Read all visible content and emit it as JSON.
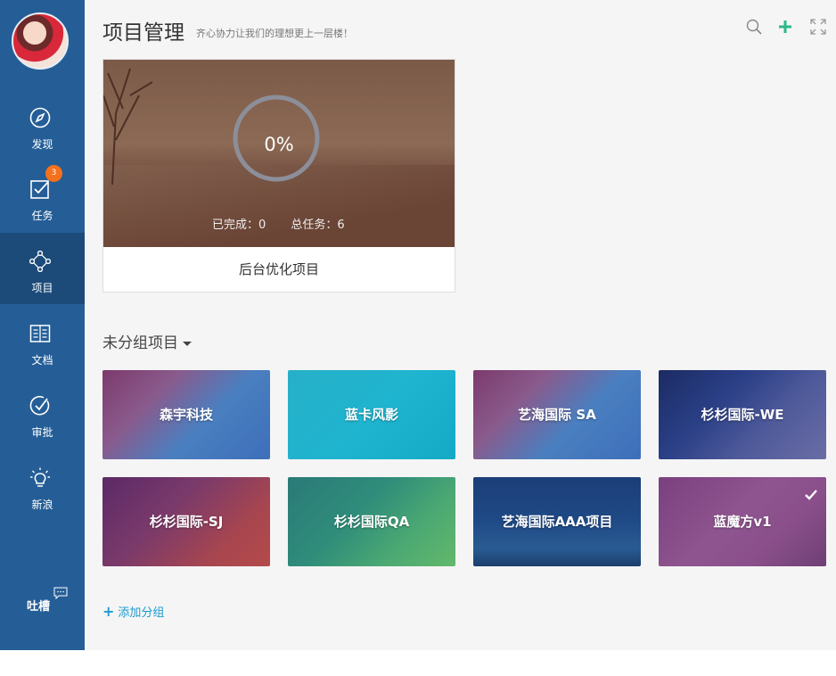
{
  "sidebar": {
    "items": [
      {
        "label": "发现",
        "icon": "compass-icon"
      },
      {
        "label": "任务",
        "icon": "checkbox-icon",
        "badge": "3"
      },
      {
        "label": "项目",
        "icon": "project-nodes-icon",
        "active": true
      },
      {
        "label": "文档",
        "icon": "book-icon"
      },
      {
        "label": "审批",
        "icon": "approval-icon"
      },
      {
        "label": "新浪",
        "icon": "lightbulb-icon"
      }
    ],
    "feedback_label": "吐槽"
  },
  "header": {
    "title": "项目管理",
    "subtitle": "齐心协力让我们的理想更上一层楼！",
    "icons": [
      "search-icon",
      "plus-icon",
      "fullscreen-icon"
    ],
    "accent": "#2bb98a"
  },
  "featured": {
    "progress": "0%",
    "progress_value": 0,
    "completed_label": "已完成：0",
    "total_label": "总任务：6",
    "name": "后台优化项目"
  },
  "group": {
    "title": "未分组项目",
    "projects": [
      {
        "name": "森宇科技"
      },
      {
        "name": "蓝卡风影"
      },
      {
        "name": "艺海国际 SA"
      },
      {
        "name": "杉杉国际-WE"
      },
      {
        "name": "杉杉国际-SJ"
      },
      {
        "name": "杉杉国际QA"
      },
      {
        "name": "艺海国际AAA项目"
      },
      {
        "name": "蓝魔方v1"
      }
    ],
    "add_label": "添加分组"
  },
  "colors": {
    "sidebar": "#255e97",
    "sidebar_active": "#1c4b7a",
    "badge": "#f5711c",
    "link": "#1d9ad0"
  }
}
